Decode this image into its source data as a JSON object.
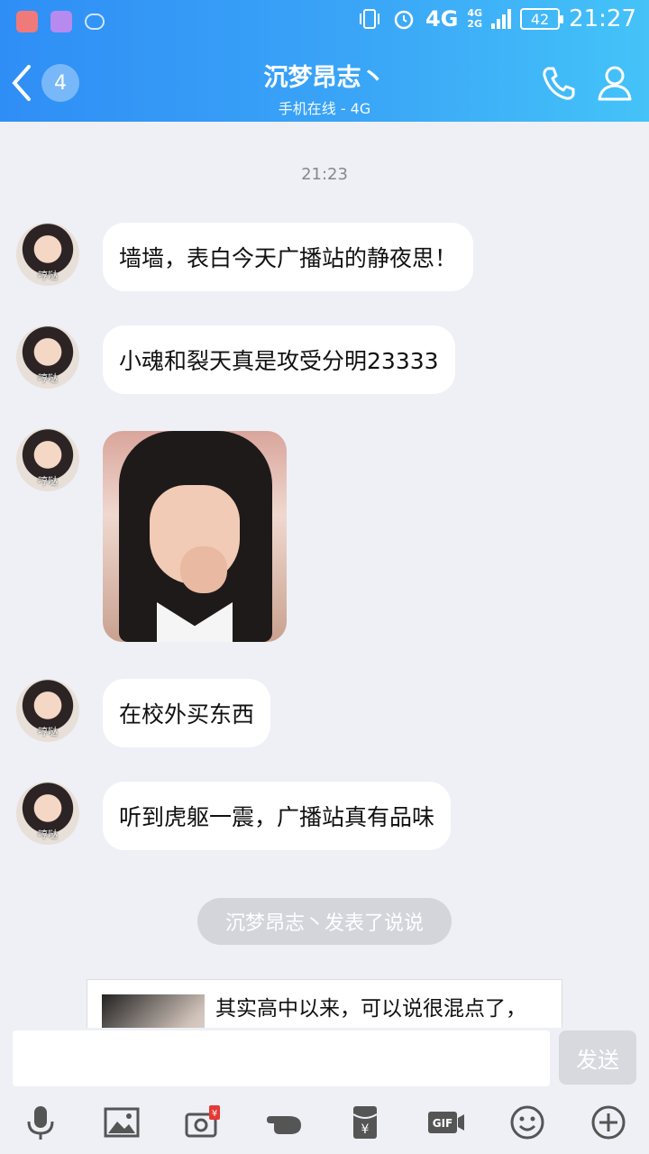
{
  "status_bar": {
    "network": "4G",
    "network_small_top": "4G",
    "network_small_bottom": "2G",
    "battery": "42",
    "time": "21:27"
  },
  "header": {
    "back_badge": "4",
    "title": "沉梦昂志丶",
    "subtitle": "手机在线 - 4G"
  },
  "chat": {
    "timestamp": "21:23",
    "avatar_caption": "哼哒",
    "messages": [
      {
        "type": "text",
        "text": "墙墙，表白今天广播站的静夜思！"
      },
      {
        "type": "text",
        "text": "小魂和裂天真是攻受分明23333"
      },
      {
        "type": "image"
      },
      {
        "type": "text",
        "text": "在校外买东西"
      },
      {
        "type": "text",
        "text": "听到虎躯一震，广播站真有品味"
      }
    ],
    "notice": "沉梦昂志丶发表了说说",
    "card_text": "其实高中以来，可以说很混点了，"
  },
  "input": {
    "value": "",
    "send_label": "发送"
  },
  "toolbar": {
    "icons": [
      "mic-icon",
      "image-icon",
      "camera-redpacket-icon",
      "poke-icon",
      "red-packet-icon",
      "gif-icon",
      "emoji-icon",
      "plus-icon"
    ]
  },
  "colors": {
    "header_start": "#2f8ef6",
    "header_end": "#44c3f8",
    "background": "#eef0f6",
    "bubble": "#ffffff",
    "red": "#e53935"
  }
}
